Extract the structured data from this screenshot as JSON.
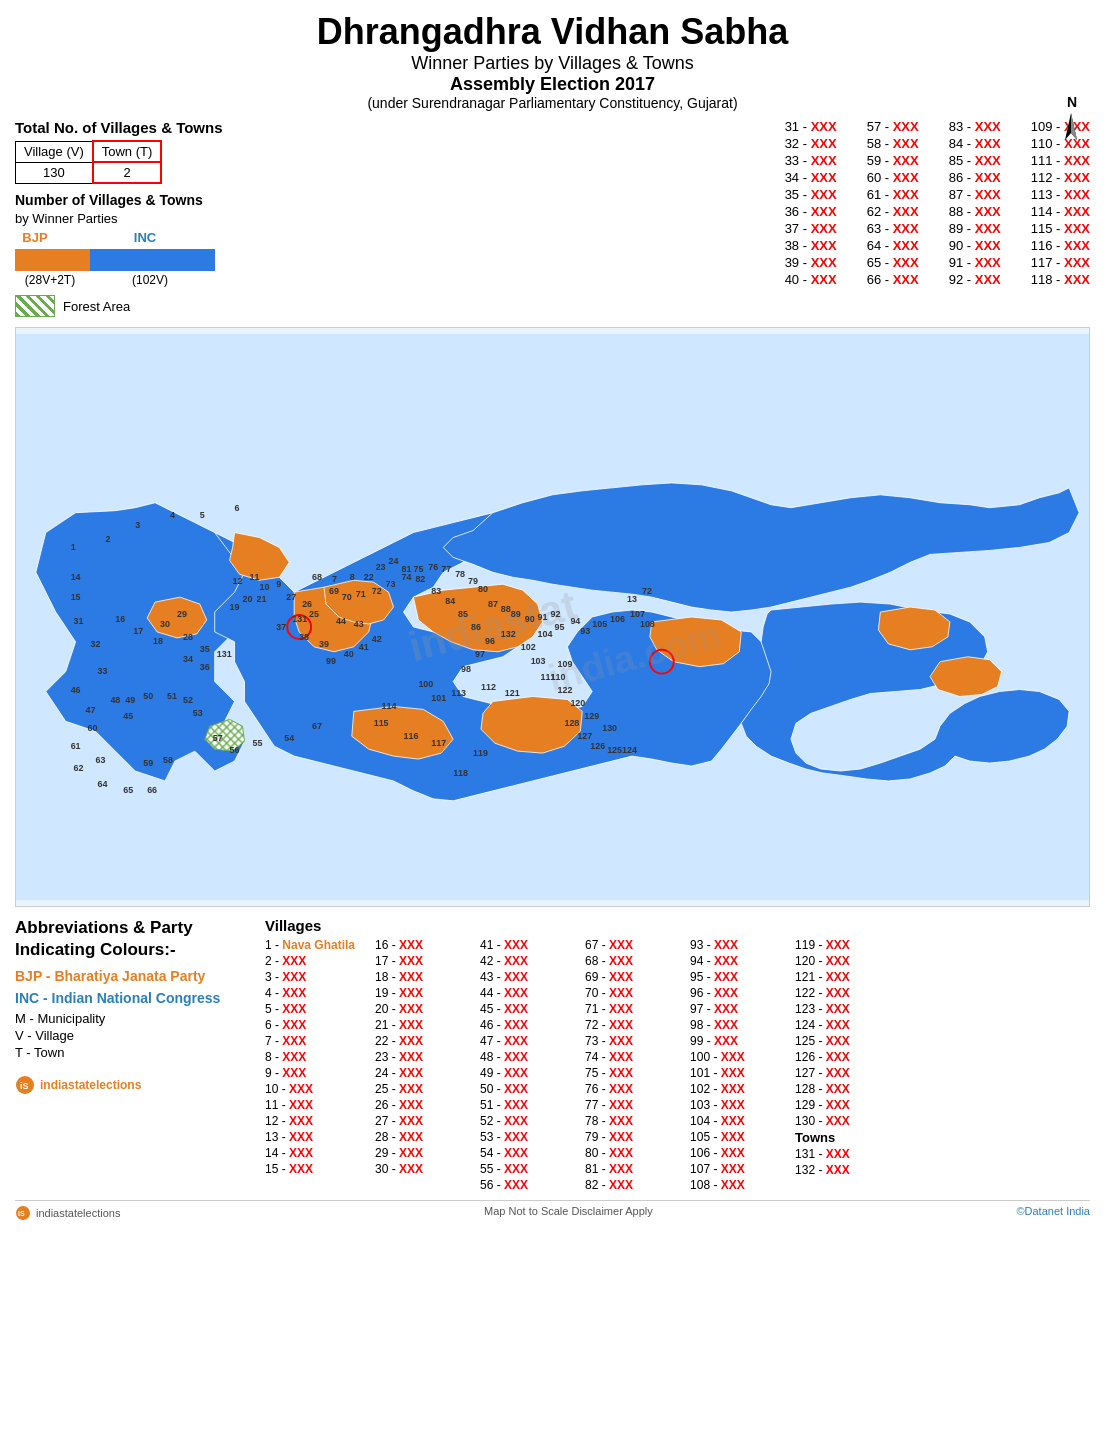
{
  "header": {
    "main_title": "Dhrangadhra Vidhan Sabha",
    "subtitle1": "Winner Parties by Villages & Towns",
    "subtitle2": "Assembly Election 2017",
    "subtitle3": "(under Surendranagar Parliamentary Constituency, Gujarat)"
  },
  "legend": {
    "total_label": "Total No. of Villages & Towns",
    "village_label": "Village (V)",
    "village_count": "130",
    "town_label": "Town (T)",
    "town_count": "2",
    "winner_title": "Number of Villages & Towns",
    "winner_subtitle": "by Winner Parties",
    "bjp_label": "BJP",
    "inc_label": "INC",
    "bjp_count": "(28V+2T)",
    "inc_count": "(102V)",
    "forest_label": "Forest Area"
  },
  "number_list": {
    "columns": [
      [
        "31 - XXX",
        "32 - XXX",
        "33 - XXX",
        "34 - XXX",
        "35 - XXX",
        "36 - XXX",
        "37 - XXX",
        "38 - XXX",
        "39 - XXX",
        "40 - XXX"
      ],
      [
        "57 - XXX",
        "58 - XXX",
        "59 - XXX",
        "60 - XXX",
        "61 - XXX",
        "62 - XXX",
        "63 - XXX",
        "64 - XXX",
        "65 - XXX",
        "66 - XXX"
      ],
      [
        "83 - XXX",
        "84 - XXX",
        "85 - XXX",
        "86 - XXX",
        "87 - XXX",
        "88 - XXX",
        "89 - XXX",
        "90 - XXX",
        "91 - XXX",
        "92 - XXX"
      ],
      [
        "109 - XXX",
        "110 - XXX",
        "111 - XXX",
        "112 - XXX",
        "113 - XXX",
        "114 - XXX",
        "115 - XXX",
        "116 - XXX",
        "117 - XXX",
        "118 - XXX"
      ]
    ]
  },
  "abbreviations": {
    "title": "Abbreviations & Party\nIndicating Colours:-",
    "bjp_full": "BJP  - Bharatiya Janata Party",
    "inc_full": "INC  - Indian National Congress",
    "municipality": "M   - Municipality",
    "village": "V    - Village",
    "town": "T    - Town"
  },
  "village_list": {
    "header": "Villages",
    "columns": [
      [
        "1 - Nava Ghatila",
        "2 - XXX",
        "3 - XXX",
        "4 - XXX",
        "5 - XXX",
        "6 - XXX",
        "7 - XXX",
        "8 - XXX",
        "9 - XXX",
        "10 - XXX",
        "11 - XXX",
        "12 - XXX",
        "13 - XXX",
        "14 - XXX",
        "15 - XXX"
      ],
      [
        "16 - XXX",
        "17 - XXX",
        "18 - XXX",
        "19 - XXX",
        "20 - XXX",
        "21 - XXX",
        "22 - XXX",
        "23 - XXX",
        "24 - XXX",
        "25 - XXX",
        "26 - XXX",
        "27 - XXX",
        "28 - XXX",
        "29 - XXX",
        "30 - XXX"
      ],
      [
        "41 - XXX",
        "42 - XXX",
        "43 - XXX",
        "44 - XXX",
        "45 - XXX",
        "46 - XXX",
        "47 - XXX",
        "48 - XXX",
        "49 - XXX",
        "50 - XXX",
        "51 - XXX",
        "52 - XXX",
        "53 - XXX",
        "54 - XXX",
        "55 - XXX",
        "56 - XXX"
      ],
      [
        "67 - XXX",
        "68 - XXX",
        "69 - XXX",
        "70 - XXX",
        "71 - XXX",
        "72 - XXX",
        "73 - XXX",
        "74 - XXX",
        "75 - XXX",
        "76 - XXX",
        "77 - XXX",
        "78 - XXX",
        "79 - XXX",
        "80 - XXX",
        "81 - XXX",
        "82 - XXX"
      ],
      [
        "93 - XXX",
        "94 - XXX",
        "95 - XXX",
        "96 - XXX",
        "97 - XXX",
        "98 - XXX",
        "99 - XXX",
        "100 - XXX",
        "101 - XXX",
        "102 - XXX",
        "103 - XXX",
        "104 - XXX",
        "105 - XXX",
        "106 - XXX",
        "107 - XXX",
        "108 - XXX"
      ],
      [
        "119 - XXX",
        "120 - XXX",
        "121 - XXX",
        "122 - XXX",
        "123 - XXX",
        "124 - XXX",
        "125 - XXX",
        "126 - XXX",
        "127 - XXX",
        "128 - XXX",
        "129 - XXX",
        "130 - XXX",
        "Towns",
        "131 - XXX",
        "132 - XXX"
      ]
    ]
  },
  "footer": {
    "logo": "indiastatelections",
    "note": "Map Not to Scale    Disclaimer Apply",
    "copyright": "©Datanet India"
  },
  "colors": {
    "bjp": "#e67e22",
    "inc": "#2c7be5",
    "forest": "#6aab4f",
    "background": "#ffffff"
  }
}
